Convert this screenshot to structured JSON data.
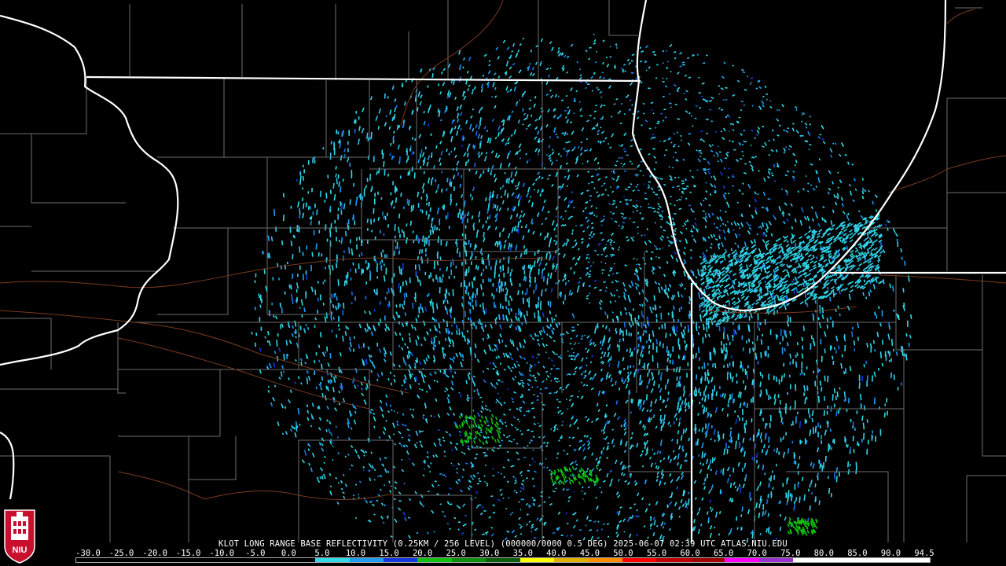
{
  "caption": {
    "text": "KLOT LONG RANGE BASE REFLECTIVITY (0.25KM / 256 LEVEL) (000000/0000 0.5 DEG) 2025-06-07 02:39 UTC  ATLAS.NIU.EDU"
  },
  "logo": {
    "text": "NIU"
  },
  "legend": {
    "ticks": [
      "-30.0",
      "-25.0",
      "-20.0",
      "-15.0",
      "-10.0",
      "-5.0",
      "0.0",
      "5.0",
      "10.0",
      "15.0",
      "20.0",
      "25.0",
      "30.0",
      "35.0",
      "40.0",
      "45.0",
      "50.0",
      "55.0",
      "60.0",
      "65.0",
      "70.0",
      "75.0",
      "80.0",
      "85.0",
      "90.0",
      "94.5"
    ],
    "colors": [
      "#000000",
      "#000000",
      "#000000",
      "#000000",
      "#000000",
      "#000000",
      "#000000",
      "#2fd9e8",
      "#1f9cf0",
      "#1437e0",
      "#10c010",
      "#0d8f0d",
      "#0a5c0a",
      "#ffff00",
      "#e0b000",
      "#ff8c00",
      "#ff0000",
      "#c00000",
      "#a00000",
      "#ff00ff",
      "#9932cc",
      "#ffffff",
      "#ffffff",
      "#ffffff",
      "#ffffff"
    ]
  },
  "map": {
    "state_color": "#ffffff",
    "county_color": "#6e6e6e",
    "road_color": "#7a3a1e",
    "echo_colors": [
      "#2fd9e8",
      "#33c3e6",
      "#1f9cf0",
      "#1a6fe6",
      "#1437e0",
      "#10c010"
    ]
  }
}
